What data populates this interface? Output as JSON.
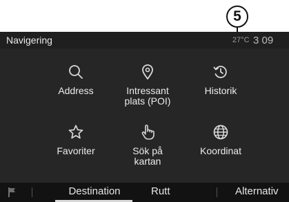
{
  "callout": {
    "number": "5"
  },
  "header": {
    "title": "Navigering",
    "temperature": "27°C",
    "time": "3 09"
  },
  "menu": {
    "items": [
      {
        "label": "Address",
        "icon": "search-icon"
      },
      {
        "label": "Intressant\nplats (POI)",
        "icon": "location-pin-icon"
      },
      {
        "label": "Historik",
        "icon": "history-icon"
      },
      {
        "label": "Favoriter",
        "icon": "star-icon"
      },
      {
        "label": "Sök på\nkartan",
        "icon": "hand-pointer-icon"
      },
      {
        "label": "Koordinat",
        "icon": "globe-icon"
      }
    ]
  },
  "tabs": {
    "flag_icon": "flag-icon",
    "items": [
      {
        "label": "Destination",
        "active": true
      },
      {
        "label": "Rutt",
        "active": false
      },
      {
        "label": "Alternativ",
        "active": false
      }
    ]
  },
  "colors": {
    "screen_bg": "#262626",
    "bottom_bar_bg": "#121212",
    "text": "#ececec",
    "icon_stroke": "#d9d9d9"
  }
}
